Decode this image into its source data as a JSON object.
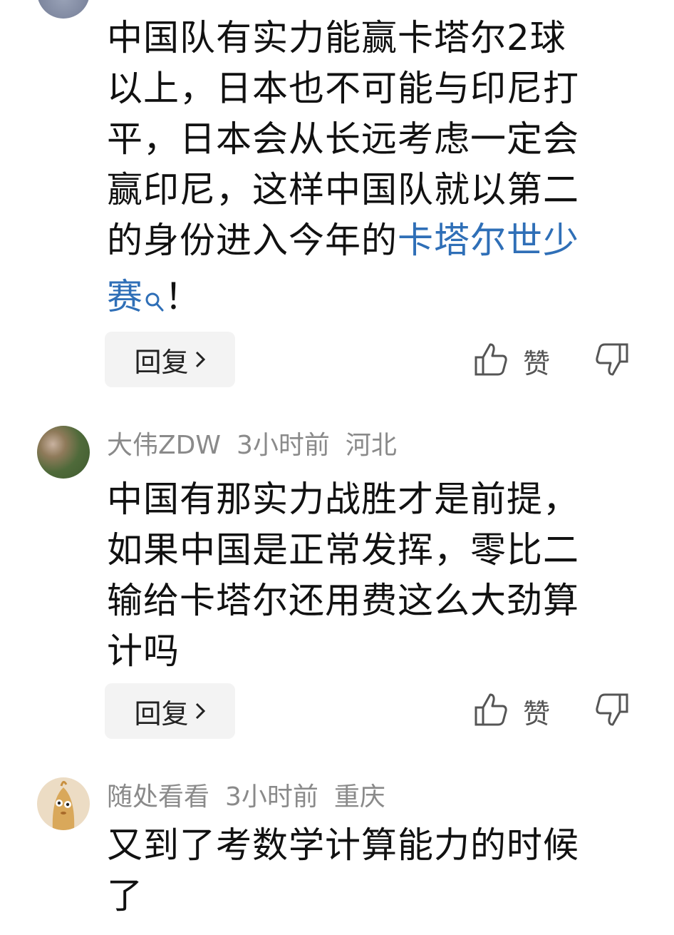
{
  "comments": [
    {
      "body_lines": [
        "中国队有实力能赢卡塔尔2球",
        "以上，日本也不可能与印尼打",
        "平，日本会从长远考虑一定会",
        "赢印尼，这样中国队就以第二",
        "的身份进入今年的"
      ],
      "link_text_1": "卡塔尔世少",
      "link_text_2": "赛",
      "tail": "！",
      "reply_label": "回复",
      "like_label": "赞"
    },
    {
      "username": "大伟ZDW",
      "time": "3小时前",
      "location": "河北",
      "body_lines": [
        "中国有那实力战胜才是前提，",
        "如果中国是正常发挥，零比二",
        "输给卡塔尔还用费这么大劲算",
        "计吗"
      ],
      "reply_label": "回复",
      "like_label": "赞"
    },
    {
      "username": "随处看看",
      "time": "3小时前",
      "location": "重庆",
      "body_lines": [
        "又到了考数学计算能力的时候",
        "了"
      ]
    }
  ],
  "icons": {
    "like": "thumbs-up-icon",
    "dislike": "thumbs-down-icon",
    "search": "search-icon",
    "chevron": "chevron-right-icon"
  },
  "colors": {
    "link": "#2f6fb7",
    "meta": "#8a8a8a",
    "reply_bg": "#f3f3f3"
  }
}
